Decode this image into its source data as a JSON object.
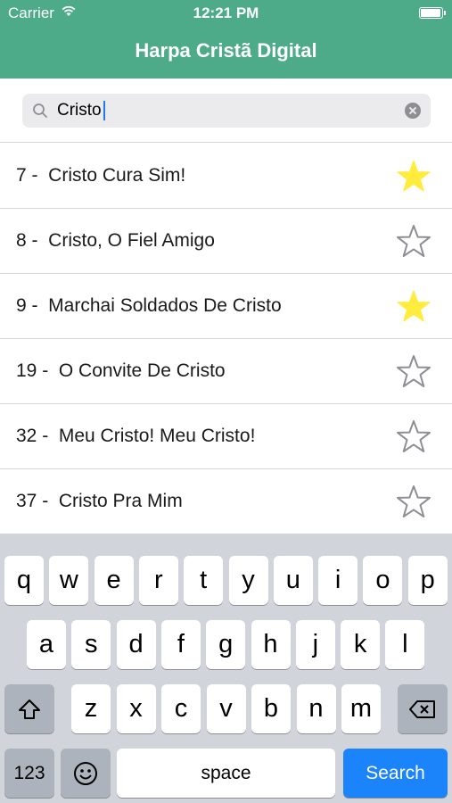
{
  "status_bar": {
    "carrier": "Carrier",
    "time": "12:21 PM",
    "battery_level": 1.0
  },
  "header": {
    "title": "Harpa Cristã Digital"
  },
  "search": {
    "value": "Cristo"
  },
  "hymns": [
    {
      "label": "7 -  Cristo Cura Sim!",
      "favorite": true
    },
    {
      "label": "8 -  Cristo, O Fiel Amigo",
      "favorite": false
    },
    {
      "label": "9 -  Marchai Soldados De Cristo",
      "favorite": true
    },
    {
      "label": "19 -  O Convite De Cristo",
      "favorite": false
    },
    {
      "label": "32 -  Meu Cristo! Meu Cristo!",
      "favorite": false
    },
    {
      "label": "37 -  Cristo Pra Mim",
      "favorite": false
    }
  ],
  "colors": {
    "header": "#4dab8a",
    "star_on": "#ffec3d",
    "star_off": "#8e8e93",
    "search_key": "#1b84fb"
  },
  "keyboard": {
    "row1": [
      "q",
      "w",
      "e",
      "r",
      "t",
      "y",
      "u",
      "i",
      "o",
      "p"
    ],
    "row2": [
      "a",
      "s",
      "d",
      "f",
      "g",
      "h",
      "j",
      "k",
      "l"
    ],
    "row3": [
      "z",
      "x",
      "c",
      "v",
      "b",
      "n",
      "m"
    ],
    "numbers_label": "123",
    "space_label": "space",
    "search_label": "Search",
    "shift_icon": "shift-icon",
    "delete_icon": "backspace-icon",
    "emoji_icon": "emoji-icon"
  }
}
